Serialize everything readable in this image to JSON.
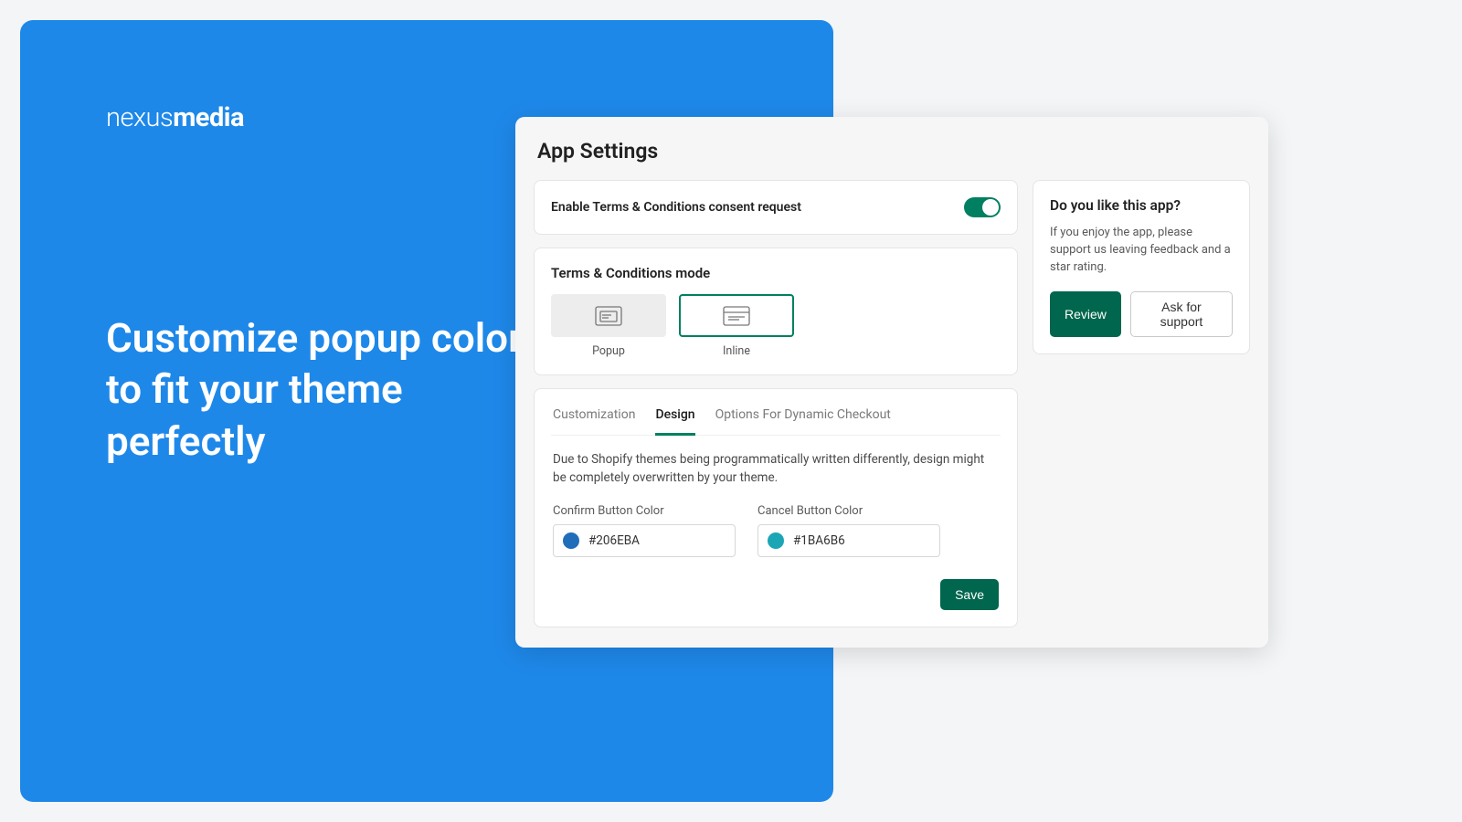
{
  "brand": {
    "light": "nexus",
    "bold": "media"
  },
  "headline": "Customize popup colors to fit your theme perfectly",
  "app": {
    "title": "App Settings",
    "enable_label": "Enable Terms & Conditions consent request",
    "mode_title": "Terms & Conditions mode",
    "modes": {
      "popup": "Popup",
      "inline": "Inline"
    },
    "tabs": {
      "customization": "Customization",
      "design": "Design",
      "dynamic": "Options For Dynamic Checkout"
    },
    "design_note": "Due to Shopify themes being programmatically written differently, design might be completely overwritten by your theme.",
    "confirm_label": "Confirm Button Color",
    "cancel_label": "Cancel Button Color",
    "confirm_color": "#206EBA",
    "cancel_color": "#1BA6B6",
    "save_label": "Save"
  },
  "side": {
    "title": "Do you like this app?",
    "text": "If you enjoy the app, please support us leaving feedback and a star rating.",
    "review": "Review",
    "support": "Ask for support"
  }
}
